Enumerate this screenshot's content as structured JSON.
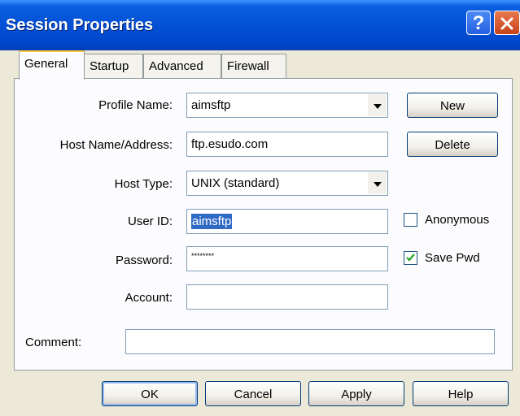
{
  "window": {
    "title": "Session Properties"
  },
  "tabs": [
    {
      "label": "General"
    },
    {
      "label": "Startup"
    },
    {
      "label": "Advanced"
    },
    {
      "label": "Firewall"
    }
  ],
  "form": {
    "profile_name_label": "Profile Name:",
    "profile_name_value": "aimsftp",
    "host_label": "Host Name/Address:",
    "host_value": "ftp.esudo.com",
    "host_type_label": "Host Type:",
    "host_type_value": "UNIX (standard)",
    "user_id_label": "User ID:",
    "user_id_value": "aimsftp",
    "password_label": "Password:",
    "password_value": "********",
    "account_label": "Account:",
    "account_value": "",
    "comment_label": "Comment:",
    "comment_value": ""
  },
  "side_buttons": {
    "new_label": "New",
    "delete_label": "Delete"
  },
  "checkboxes": {
    "anonymous_label": "Anonymous",
    "anonymous_checked": false,
    "save_pwd_label": "Save Pwd",
    "save_pwd_checked": true
  },
  "buttons": {
    "ok": "OK",
    "cancel": "Cancel",
    "apply": "Apply",
    "help": "Help"
  },
  "colors": {
    "titlebar": "#0450D6",
    "selection": "#316AC5",
    "dialog_bg": "#ECE9D8"
  }
}
